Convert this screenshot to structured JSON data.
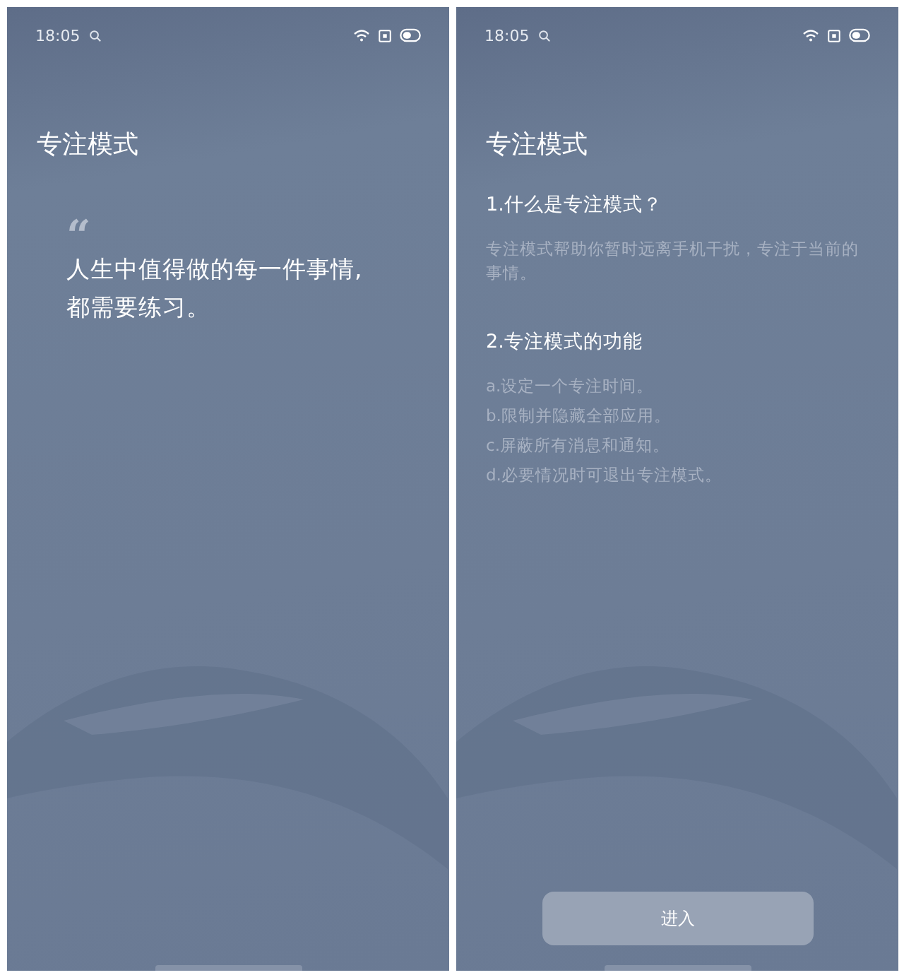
{
  "screens": [
    {
      "kind": "quote",
      "status_bar": {
        "time": "18:05"
      },
      "title": "专注模式",
      "quote_mark": "“",
      "quote": [
        "人生中值得做的每一件事情,",
        "都需要练习。"
      ]
    },
    {
      "kind": "info",
      "status_bar": {
        "time": "18:05"
      },
      "title": "专注模式",
      "sections": [
        {
          "heading": "1.什么是专注模式？",
          "lines": [
            "专注模式帮助你暂时远离手机干扰，专注于当前的事情。"
          ]
        },
        {
          "heading": "2.专注模式的功能",
          "lines": [
            "a.设定一个专注时间。",
            "b.限制并隐藏全部应用。",
            "c.屏蔽所有消息和通知。",
            "d.必要情况时可退出专注模式。"
          ]
        }
      ],
      "button": "进入"
    }
  ]
}
